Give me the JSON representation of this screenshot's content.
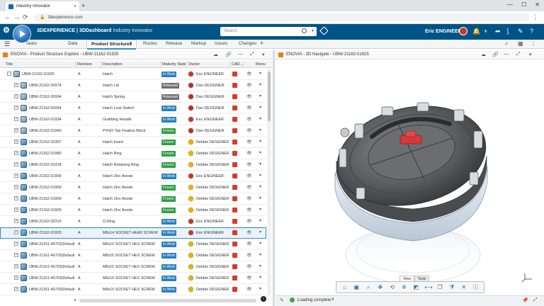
{
  "browser": {
    "tab_title": "Industry Innovator",
    "tab_close": "×",
    "new_tab": "+",
    "url": "3dexperience.com",
    "window_controls": [
      "—",
      "☐",
      "✕"
    ]
  },
  "topbar": {
    "brand_bold": "3DEXPERIENCE",
    "brand_mid": " | 3DDashboard",
    "brand_light": "Industry Innovator",
    "search_placeholder": "Search",
    "user_name": "Eric ENGINEER"
  },
  "app_tabs": [
    "Tasks",
    "Data",
    "Product Structures",
    "Routes",
    "Release",
    "Markup",
    "Issues",
    "Changes"
  ],
  "left_panel": {
    "title": "ENOVIA - Product Structure Explore - UBW-21162-01925"
  },
  "right_panel": {
    "title": "ENOVIA - 3D Navigate - UBW-21162-01925"
  },
  "table": {
    "headers": [
      "Title",
      "Revision",
      "Description",
      "Maturity State",
      "Owner",
      "CAD...",
      "Menu"
    ],
    "rows": [
      {
        "title": "UBW-21162-01925",
        "rev": "A",
        "desc": "Hatch",
        "state": "In Work",
        "owner": "Eric ENGINEER",
        "level": 0,
        "icon": "assy"
      },
      {
        "title": "UBW-21162-02074",
        "rev": "A",
        "desc": "Hatch Lid",
        "state": "Released",
        "owner": "Dan DESIGNER",
        "level": 1,
        "icon": "assy"
      },
      {
        "title": "UBW-21162-02004",
        "rev": "A",
        "desc": "Hatch Spring",
        "state": "Released",
        "owner": "Dan DESIGNER",
        "level": 1,
        "icon": "assy"
      },
      {
        "title": "UBW-21162-02064",
        "rev": "A",
        "desc": "Hatch Lock Switch",
        "state": "In Work",
        "owner": "Dan DESIGNER",
        "level": 1,
        "icon": "assy"
      },
      {
        "title": "UBW-21162-01934",
        "rev": "A",
        "desc": "Grabbing Handle",
        "state": "In Work",
        "owner": "Eric ENGINEER",
        "level": 1,
        "icon": "assy"
      },
      {
        "title": "UBW-21162-01940",
        "rev": "A",
        "desc": "PVHO Top Fixation Block",
        "state": "Frozen",
        "owner": "Dan DESIGNER",
        "level": 1,
        "icon": "assy"
      },
      {
        "title": "UBW-21162-02307",
        "rev": "A",
        "desc": "Hatch Insert",
        "state": "Frozen",
        "owner": "Debbie DESIGNER",
        "level": 1,
        "icon": "part"
      },
      {
        "title": "UBW-21162-01980",
        "rev": "A",
        "desc": "Hatch Ring",
        "state": "Frozen",
        "owner": "Debbie DESIGNER",
        "level": 1,
        "icon": "part"
      },
      {
        "title": "UBW-21162-02318",
        "rev": "A",
        "desc": "Hatch Retaining Ring",
        "state": "Frozen",
        "owner": "Debbie DESIGNER",
        "level": 1,
        "icon": "part"
      },
      {
        "title": "UBW-21162-01909",
        "rev": "A",
        "desc": "Hatch Zinc Anode",
        "state": "In Work",
        "owner": "Eric ENGINEER",
        "level": 1,
        "icon": "part"
      },
      {
        "title": "UBW-21162-01909",
        "rev": "A",
        "desc": "Hatch Zinc Anode",
        "state": "Frozen",
        "owner": "Debbie DESIGNER",
        "level": 1,
        "icon": "part"
      },
      {
        "title": "UBW-21162-01909",
        "rev": "A",
        "desc": "Hatch Zinc Anode",
        "state": "Frozen",
        "owner": "Debbie DESIGNER",
        "level": 1,
        "icon": "part"
      },
      {
        "title": "UBW-21162-01909",
        "rev": "A",
        "desc": "Hatch Zinc Anode",
        "state": "Frozen",
        "owner": "Debbie DESIGNER",
        "level": 1,
        "icon": "part"
      },
      {
        "title": "UBW-21162-02319",
        "rev": "A",
        "desc": "O-Ring",
        "state": "In Work",
        "owner": "Eric ENGINEER",
        "level": 1,
        "icon": "part"
      },
      {
        "title": "UBW-21162-01925",
        "rev": "A",
        "desc": "M8x14 SOCKET HEAD SCREW",
        "state": "In Work",
        "owner": "Eric ENGINEER",
        "level": 1,
        "icon": "part",
        "selected": true
      },
      {
        "title": "UBW-21161-46703(Default)",
        "rev": "A",
        "desc": "M8x15 SOCKET HEX SCREW",
        "state": "In Work",
        "owner": "Debbie DESIGNER",
        "level": 1,
        "icon": "part"
      },
      {
        "title": "UBW-21161-46703(Default)",
        "rev": "A",
        "desc": "M8x15 SOCKET HEX SCREW",
        "state": "In Work",
        "owner": "Debbie DESIGNER",
        "level": 1,
        "icon": "part"
      },
      {
        "title": "UBW-21161-46703(Default)",
        "rev": "A",
        "desc": "M8x15 SOCKET HEX SCREW",
        "state": "In Work",
        "owner": "Debbie DESIGNER",
        "level": 1,
        "icon": "part"
      },
      {
        "title": "UBW-21161-46703(Default)",
        "rev": "A",
        "desc": "M8x15 SOCKET HEX SCREW",
        "state": "In Work",
        "owner": "Debbie DESIGNER",
        "level": 1,
        "icon": "part"
      },
      {
        "title": "UBW-21161-46703(Default)",
        "rev": "A",
        "desc": "M8x15 SOCKET HEX SCREW",
        "state": "In Work",
        "owner": "Debbie DESIGNER",
        "level": 1,
        "icon": "part"
      }
    ]
  },
  "state_colors": {
    "In Work": "#2a7fc1",
    "Released": "#6e6e6e",
    "Frozen": "#2f9e44"
  },
  "owner_colors": {
    "Eric ENGINEER": "#c23b2a",
    "Dan DESIGNER": "#b83224",
    "Debbie DESIGNER": "#e0b400"
  },
  "viewer": {
    "tabs": [
      "View",
      "Tools"
    ],
    "toolbar_icons": [
      "home-icon",
      "fit-all-icon",
      "zoom-icon",
      "pan-icon",
      "rotate-icon",
      "explode-icon",
      "section-icon",
      "measure-icon",
      "ghost-icon",
      "filter-icon",
      "close-icon",
      "info-icon"
    ]
  },
  "status": {
    "text": "Loading complete"
  },
  "colors": {
    "topbar": "#005386",
    "accent": "#368ec4"
  }
}
